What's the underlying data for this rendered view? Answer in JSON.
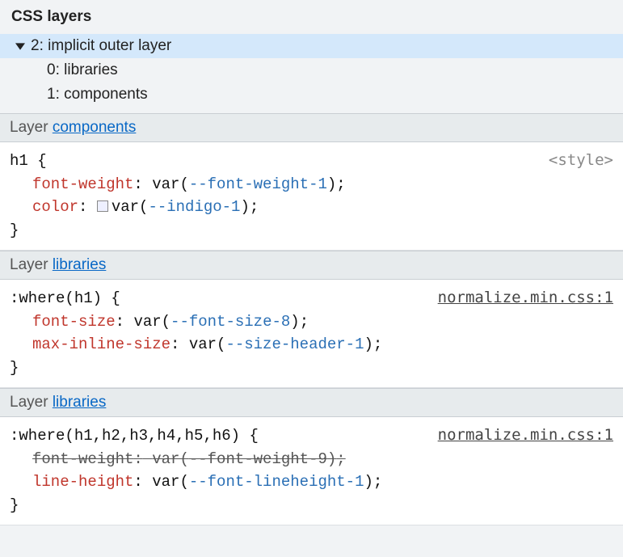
{
  "title": "CSS layers",
  "tree": {
    "root": {
      "index": "2",
      "label": "implicit outer layer",
      "expanded": true
    },
    "children": [
      {
        "index": "0",
        "label": "libraries"
      },
      {
        "index": "1",
        "label": "components"
      }
    ]
  },
  "layer_prefix": "Layer",
  "rules": [
    {
      "layer": "components",
      "selector": "h1",
      "source": "<style>",
      "source_is_tag": true,
      "declarations": [
        {
          "prop": "font-weight",
          "var": "--font-weight-1",
          "swatch": false,
          "struck": false
        },
        {
          "prop": "color",
          "var": "--indigo-1",
          "swatch": true,
          "struck": false
        }
      ]
    },
    {
      "layer": "libraries",
      "selector": ":where(h1)",
      "source": "normalize.min.css:1",
      "source_is_tag": false,
      "declarations": [
        {
          "prop": "font-size",
          "var": "--font-size-8",
          "swatch": false,
          "struck": false
        },
        {
          "prop": "max-inline-size",
          "var": "--size-header-1",
          "swatch": false,
          "struck": false
        }
      ]
    },
    {
      "layer": "libraries",
      "selector": ":where(h1,h2,h3,h4,h5,h6)",
      "source": "normalize.min.css:1",
      "source_is_tag": false,
      "declarations": [
        {
          "prop": "font-weight",
          "var": "--font-weight-9",
          "swatch": false,
          "struck": true
        },
        {
          "prop": "line-height",
          "var": "--font-lineheight-1",
          "swatch": false,
          "struck": false
        }
      ]
    }
  ]
}
